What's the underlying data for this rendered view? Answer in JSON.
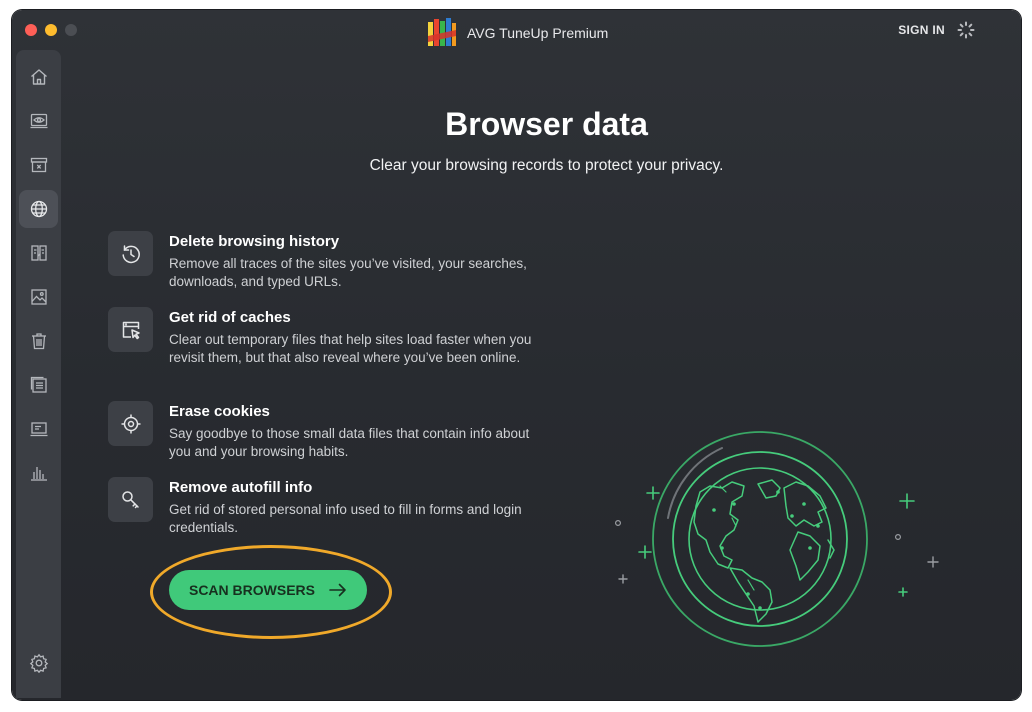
{
  "window": {
    "title": "AVG TuneUp Premium",
    "sign_in": "SIGN IN"
  },
  "sidebar": {
    "items": [
      {
        "name": "home",
        "icon": "home-icon",
        "active": false
      },
      {
        "name": "performance",
        "icon": "eye-drive-icon",
        "active": false
      },
      {
        "name": "cleanup",
        "icon": "archive-box-icon",
        "active": false
      },
      {
        "name": "browser-data",
        "icon": "globe-icon",
        "active": true
      },
      {
        "name": "duplicates",
        "icon": "compare-files-icon",
        "active": false
      },
      {
        "name": "photos",
        "icon": "image-icon",
        "active": false
      },
      {
        "name": "uninstaller",
        "icon": "trash-icon",
        "active": false
      },
      {
        "name": "files",
        "icon": "file-list-icon",
        "active": false
      },
      {
        "name": "apps",
        "icon": "laptop-icon",
        "active": false
      },
      {
        "name": "stats",
        "icon": "bar-chart-icon",
        "active": false
      }
    ],
    "settings_icon": "gear-icon"
  },
  "main": {
    "title": "Browser data",
    "subtitle": "Clear your browsing records to protect your privacy.",
    "features": [
      {
        "icon": "history-clock-icon",
        "title": "Delete browsing history",
        "description": "Remove all traces of the sites you’ve visited, your searches, downloads, and typed URLs."
      },
      {
        "icon": "cache-window-icon",
        "title": "Get rid of caches",
        "description": "Clear out temporary files that help sites load faster when you revisit them, but that also reveal where you’ve been online."
      },
      {
        "icon": "cookie-target-icon",
        "title": "Erase cookies",
        "description": "Say goodbye to those small data files that contain info about you and your browsing habits."
      },
      {
        "icon": "key-icon",
        "title": "Remove autofill info",
        "description": "Get rid of stored personal info used to fill in forms and login credentials."
      }
    ],
    "scan_button": "SCAN BROWSERS"
  },
  "colors": {
    "accent_green": "#40c97a",
    "highlight_orange": "#f0a92a",
    "background": "#2b2e33",
    "sidebar": "#3b3e44"
  }
}
